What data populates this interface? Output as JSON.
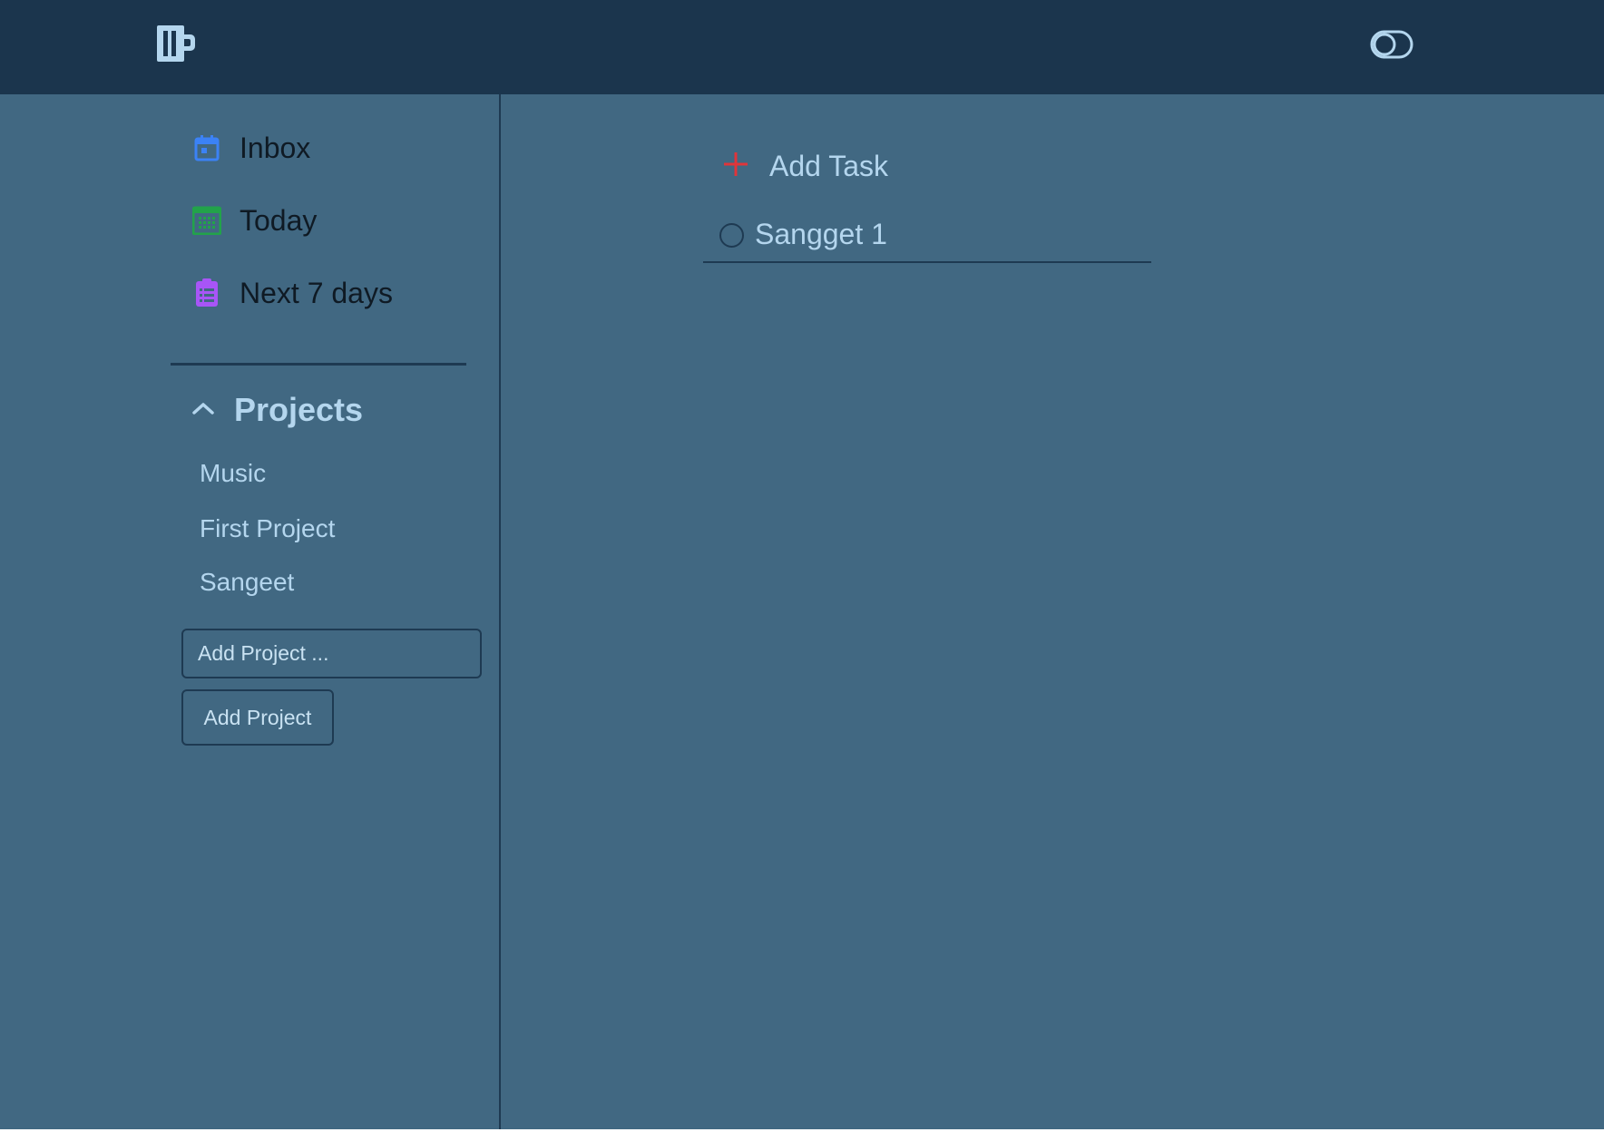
{
  "colors": {
    "header_bg": "#1b354d",
    "content_bg": "#416882",
    "text_light": "#b4d6ee",
    "inbox_icon": "#3b82f6",
    "today_icon": "#22a34a",
    "next7_icon": "#a855f7",
    "add_icon": "#e0353a"
  },
  "header": {
    "logo_icon": "beer-mug-icon",
    "toggle_icon": "theme-toggle-icon"
  },
  "sidebar": {
    "nav": [
      {
        "label": "Inbox",
        "icon": "calendar-icon"
      },
      {
        "label": "Today",
        "icon": "calendar-grid-icon"
      },
      {
        "label": "Next 7 days",
        "icon": "clipboard-list-icon"
      }
    ],
    "projects": {
      "title": "Projects",
      "icon": "chevron-up-icon",
      "items": [
        {
          "label": "Music"
        },
        {
          "label": "First Project"
        },
        {
          "label": "Sangeet"
        }
      ],
      "add_input_placeholder": "Add Project ...",
      "add_button_label": "Add Project"
    }
  },
  "main": {
    "add_task_label": "Add Task",
    "tasks": [
      {
        "label": "Sangget 1",
        "done": false
      }
    ]
  }
}
